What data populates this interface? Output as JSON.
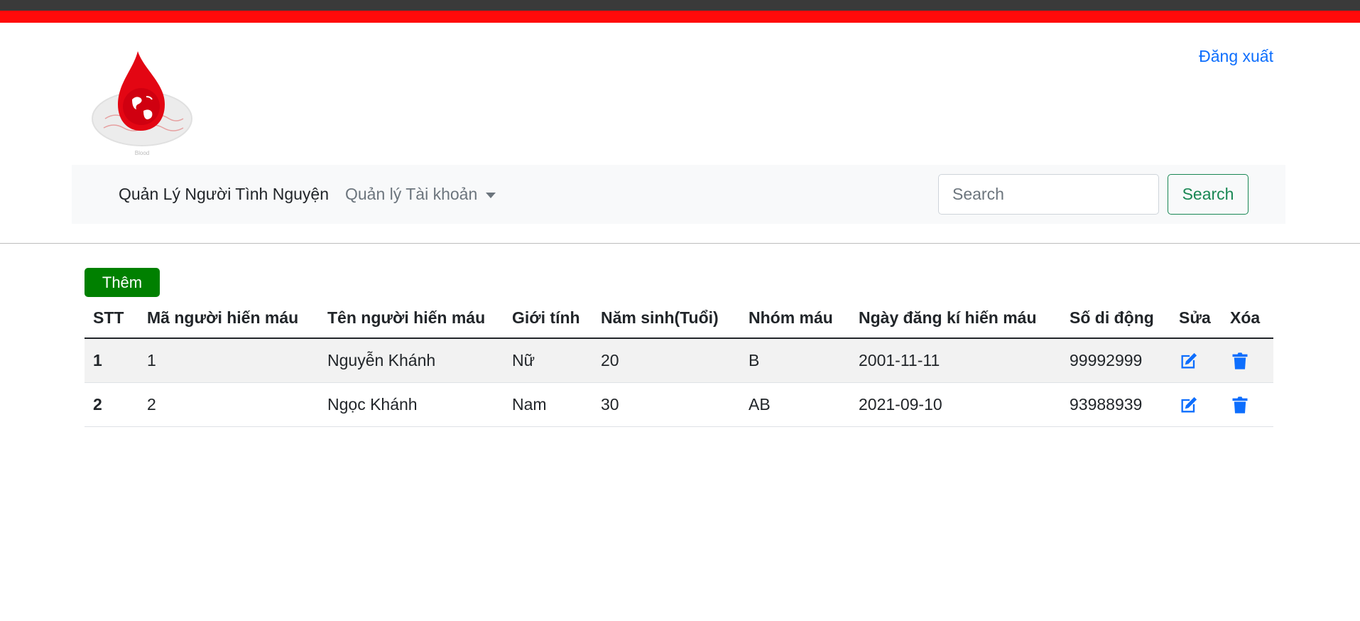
{
  "header": {
    "logout_label": "Đăng xuất"
  },
  "navbar": {
    "brand_label": "Quản Lý Người Tình Nguyện",
    "dropdown_label": "Quản lý Tài khoản",
    "search_placeholder": "Search",
    "search_value": "",
    "search_button_label": "Search"
  },
  "main": {
    "add_button_label": "Thêm",
    "table": {
      "columns": [
        "STT",
        "Mã người hiến máu",
        "Tên người hiến máu",
        "Giới tính",
        "Năm sinh(Tuổi)",
        "Nhóm máu",
        "Ngày đăng kí hiến máu",
        "Số di động",
        "Sửa",
        "Xóa"
      ],
      "rows": [
        {
          "stt": "1",
          "id": "1",
          "name": "Nguyễn Khánh",
          "gender": "Nữ",
          "age": "20",
          "blood": "B",
          "date": "2001-11-11",
          "phone": "99992999",
          "edit_icon": "edit-icon",
          "delete_icon": "trash-icon"
        },
        {
          "stt": "2",
          "id": "2",
          "name": "Ngọc Khánh",
          "gender": "Nam",
          "age": "30",
          "blood": "AB",
          "date": "2021-09-10",
          "phone": "93988939",
          "edit_icon": "edit-icon",
          "delete_icon": "trash-icon"
        }
      ]
    }
  },
  "colors": {
    "topbar_dark": "#3a3a3a",
    "topbar_red": "#ff0a0a",
    "link": "#0d6efd",
    "success": "#198754",
    "add_button": "#008000",
    "icon": "#0d6efd"
  }
}
